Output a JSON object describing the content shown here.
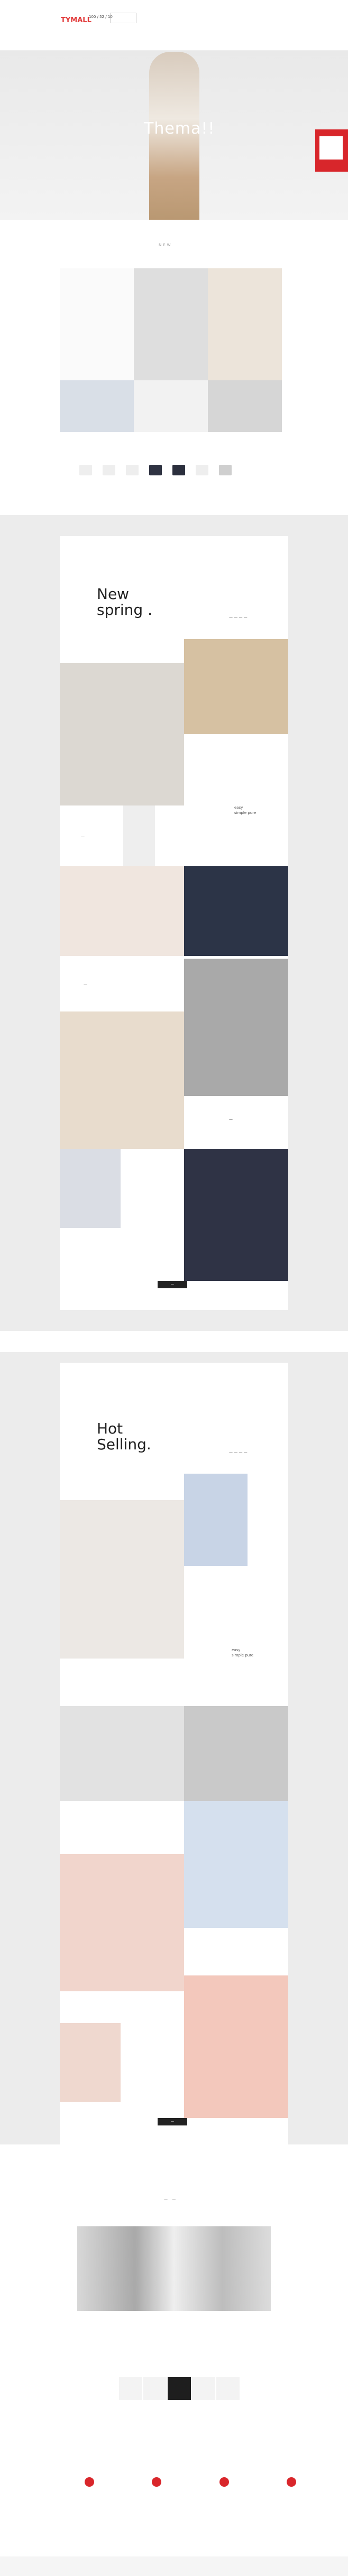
{
  "header": {
    "logo": "TYMALL",
    "promo": "100 / 52 / 10",
    "search_placeholder": "",
    "nav_items": [
      "",
      "",
      "",
      "",
      "",
      "",
      "",
      "",
      "",
      "",
      ""
    ]
  },
  "hero": {
    "text": "Thema!!"
  },
  "section_one": {
    "title": "NEW"
  },
  "new_spring": {
    "title_line1": "New",
    "title_line2": "spring .",
    "small_label": "— — — —",
    "label_left": "—",
    "label_right_1": "easy",
    "label_right_2": "simple pure",
    "label_mid": "—",
    "label_bottom": "—",
    "btn": "—"
  },
  "hot_selling": {
    "title_line1": "Hot",
    "title_line2": "Selling.",
    "small_label": "— — — —",
    "label_right_1": "easy",
    "label_right_2": "simple pure",
    "btn": "—"
  },
  "about": {
    "title": "— —"
  }
}
